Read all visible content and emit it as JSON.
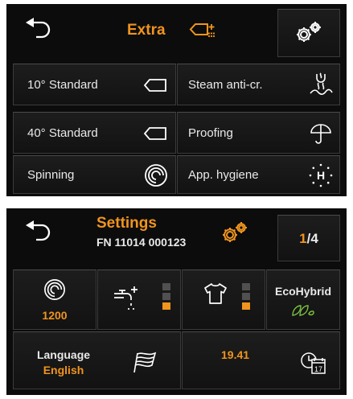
{
  "extra_panel": {
    "title": "Extra",
    "title_icon": "extra-program-icon",
    "back_icon": "back-arrow-icon",
    "settings_icon": "settings-gears-icon",
    "programs": [
      {
        "label": "10° Standard",
        "icon": "standard-tag-icon"
      },
      {
        "label": "Steam anti-cr.",
        "icon": "steam-icon"
      },
      {
        "label": "40° Standard",
        "icon": "standard-tag-icon"
      },
      {
        "label": "Proofing",
        "icon": "umbrella-icon"
      },
      {
        "label": "Spinning",
        "icon": "spin-icon"
      },
      {
        "label": "App. hygiene",
        "icon": "hygiene-icon"
      }
    ]
  },
  "settings_panel": {
    "title": "Settings",
    "subtitle": "FN 11014 000123",
    "page_current": "1",
    "page_sep": "/4",
    "spin_speed": "1200",
    "water_level": {
      "filled_segments": 1,
      "total_segments": 3
    },
    "rinse_level": {
      "filled_segments": 1,
      "total_segments": 3
    },
    "eco_label": "EcoHybrid",
    "language_label": "Language",
    "language_value": "English",
    "time": "19.41",
    "calendar_day": "17"
  },
  "colors": {
    "accent": "#f0941e",
    "text": "#e9e9e9",
    "background": "#0c0c0c",
    "eco": "#7cc242"
  }
}
